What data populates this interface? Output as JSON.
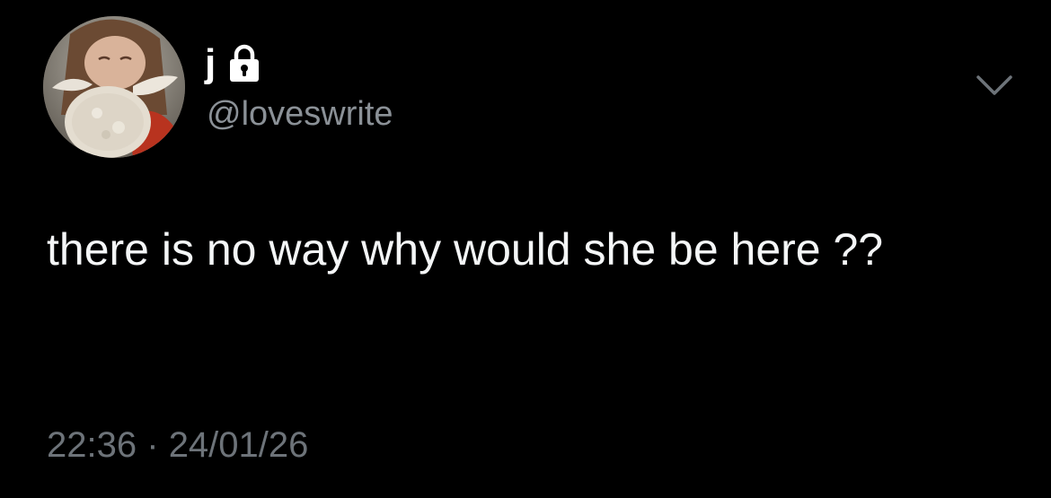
{
  "author": {
    "display_name": "j",
    "handle": "@loveswrite",
    "protected": true,
    "lock_icon": "lock-icon",
    "avatar_icon": "profile-photo"
  },
  "tweet": {
    "text": "there is no way why would she be here ??",
    "time": "22:36",
    "separator": "·",
    "date": "24/01/26"
  },
  "actions": {
    "more_icon": "chevron-down-icon"
  },
  "colors": {
    "background": "#000000",
    "text": "#f4f6f7",
    "secondary": "#8b9197",
    "meta": "#6d7379"
  }
}
